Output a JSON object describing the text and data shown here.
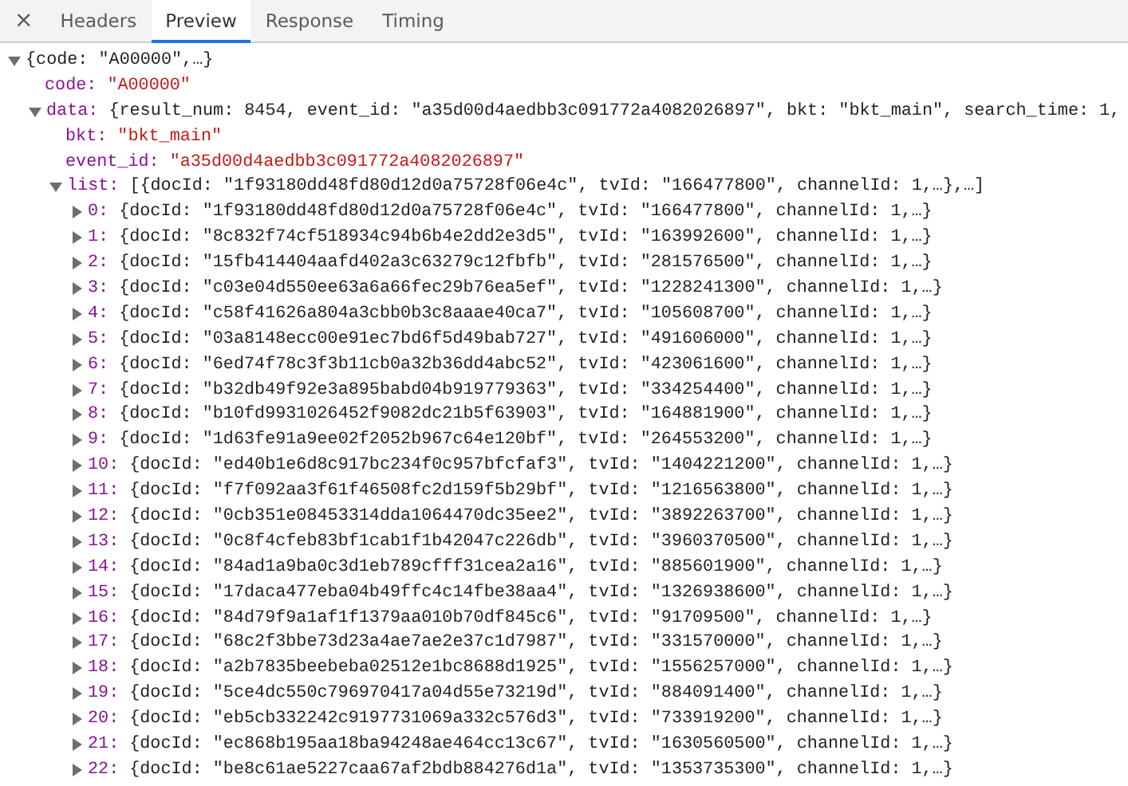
{
  "close_label": "×",
  "tabs": [
    {
      "label": "Headers",
      "selected": false
    },
    {
      "label": "Preview",
      "selected": true
    },
    {
      "label": "Response",
      "selected": false
    },
    {
      "label": "Timing",
      "selected": false
    }
  ],
  "tree": {
    "expanded": true,
    "summary": "{code: \"A00000\",…}",
    "children": [
      {
        "key": "code:",
        "value": "\"A00000\"",
        "kind": "string"
      },
      {
        "key": "data:",
        "expanded": true,
        "summary": "{result_num: 8454, event_id: \"a35d00d4aedbb3c091772a4082026897\", bkt: \"bkt_main\", search_time: 1,",
        "children": [
          {
            "key": "bkt:",
            "value": "\"bkt_main\"",
            "kind": "string"
          },
          {
            "key": "event_id:",
            "value": "\"a35d00d4aedbb3c091772a4082026897\"",
            "kind": "string"
          },
          {
            "key": "list:",
            "expanded": true,
            "summary": "[{docId: \"1f93180dd48fd80d12d0a75728f06e4c\", tvId: \"166477800\", channelId: 1,…},…]",
            "children": [
              {
                "key": "0:",
                "expanded": false,
                "summary": "{docId: \"1f93180dd48fd80d12d0a75728f06e4c\", tvId: \"166477800\", channelId: 1,…}"
              },
              {
                "key": "1:",
                "expanded": false,
                "summary": "{docId: \"8c832f74cf518934c94b6b4e2dd2e3d5\", tvId: \"163992600\", channelId: 1,…}"
              },
              {
                "key": "2:",
                "expanded": false,
                "summary": "{docId: \"15fb414404aafd402a3c63279c12fbfb\", tvId: \"281576500\", channelId: 1,…}"
              },
              {
                "key": "3:",
                "expanded": false,
                "summary": "{docId: \"c03e04d550ee63a6a66fec29b76ea5ef\", tvId: \"1228241300\", channelId: 1,…}"
              },
              {
                "key": "4:",
                "expanded": false,
                "summary": "{docId: \"c58f41626a804a3cbb0b3c8aaae40ca7\", tvId: \"105608700\", channelId: 1,…}"
              },
              {
                "key": "5:",
                "expanded": false,
                "summary": "{docId: \"03a8148ecc00e91ec7bd6f5d49bab727\", tvId: \"491606000\", channelId: 1,…}"
              },
              {
                "key": "6:",
                "expanded": false,
                "summary": "{docId: \"6ed74f78c3f3b11cb0a32b36dd4abc52\", tvId: \"423061600\", channelId: 1,…}"
              },
              {
                "key": "7:",
                "expanded": false,
                "summary": "{docId: \"b32db49f92e3a895babd04b919779363\", tvId: \"334254400\", channelId: 1,…}"
              },
              {
                "key": "8:",
                "expanded": false,
                "summary": "{docId: \"b10fd9931026452f9082dc21b5f63903\", tvId: \"164881900\", channelId: 1,…}"
              },
              {
                "key": "9:",
                "expanded": false,
                "summary": "{docId: \"1d63fe91a9ee02f2052b967c64e120bf\", tvId: \"264553200\", channelId: 1,…}"
              },
              {
                "key": "10:",
                "expanded": false,
                "summary": "{docId: \"ed40b1e6d8c917bc234f0c957bfcfaf3\", tvId: \"1404221200\", channelId: 1,…}"
              },
              {
                "key": "11:",
                "expanded": false,
                "summary": "{docId: \"f7f092aa3f61f46508fc2d159f5b29bf\", tvId: \"1216563800\", channelId: 1,…}"
              },
              {
                "key": "12:",
                "expanded": false,
                "summary": "{docId: \"0cb351e08453314dda1064470dc35ee2\", tvId: \"3892263700\", channelId: 1,…}"
              },
              {
                "key": "13:",
                "expanded": false,
                "summary": "{docId: \"0c8f4cfeb83bf1cab1f1b42047c226db\", tvId: \"3960370500\", channelId: 1,…}"
              },
              {
                "key": "14:",
                "expanded": false,
                "summary": "{docId: \"84ad1a9ba0c3d1eb789cfff31cea2a16\", tvId: \"885601900\", channelId: 1,…}"
              },
              {
                "key": "15:",
                "expanded": false,
                "summary": "{docId: \"17daca477eba04b49ffc4c14fbe38aa4\", tvId: \"1326938600\", channelId: 1,…}"
              },
              {
                "key": "16:",
                "expanded": false,
                "summary": "{docId: \"84d79f9a1af1f1379aa010b70df845c6\", tvId: \"91709500\", channelId: 1,…}"
              },
              {
                "key": "17:",
                "expanded": false,
                "summary": "{docId: \"68c2f3bbe73d23a4ae7ae2e37c1d7987\", tvId: \"331570000\", channelId: 1,…}"
              },
              {
                "key": "18:",
                "expanded": false,
                "summary": "{docId: \"a2b7835beebeba02512e1bc8688d1925\", tvId: \"1556257000\", channelId: 1,…}"
              },
              {
                "key": "19:",
                "expanded": false,
                "summary": "{docId: \"5ce4dc550c796970417a04d55e73219d\", tvId: \"884091400\", channelId: 1,…}"
              },
              {
                "key": "20:",
                "expanded": false,
                "summary": "{docId: \"eb5cb332242c9197731069a332c576d3\", tvId: \"733919200\", channelId: 1,…}"
              },
              {
                "key": "21:",
                "expanded": false,
                "summary": "{docId: \"ec868b195aa18ba94248ae464cc13c67\", tvId: \"1630560500\", channelId: 1,…}"
              },
              {
                "key": "22:",
                "expanded": false,
                "summary": "{docId: \"be8c61ae5227caa67af2bdb884276d1a\", tvId: \"1353735300\", channelId: 1,…}"
              }
            ]
          }
        ]
      }
    ]
  }
}
